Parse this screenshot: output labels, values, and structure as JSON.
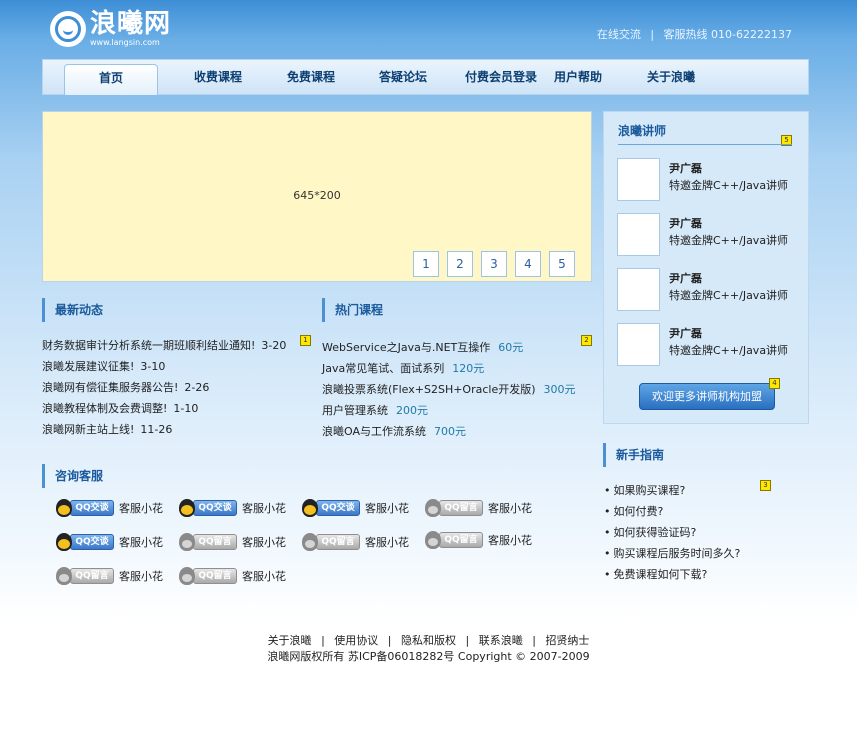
{
  "header": {
    "logo_text": "浪曦网",
    "logo_url": "www.langsin.com",
    "link_online": "在线交流",
    "separator": "|",
    "hotline": "客服热线 010-62222137"
  },
  "nav": {
    "items": [
      {
        "label": "首页"
      },
      {
        "label": "收费课程"
      },
      {
        "label": "免费课程"
      },
      {
        "label": "答疑论坛"
      },
      {
        "label": "付费会员登录"
      },
      {
        "label": "用户帮助"
      },
      {
        "label": "关于浪曦"
      }
    ]
  },
  "banner": {
    "label": "645*200",
    "pages": [
      "1",
      "2",
      "3",
      "4",
      "5"
    ]
  },
  "news": {
    "title": "最新动态",
    "badge": "1",
    "items": [
      {
        "text": "财务数据审计分析系统一期班顺利结业通知!",
        "date": "3-20"
      },
      {
        "text": "浪曦发展建议征集!",
        "date": "3-10"
      },
      {
        "text": "浪曦网有偿征集服务器公告!",
        "date": "2-26"
      },
      {
        "text": "浪曦教程体制及会费调整!",
        "date": "1-10"
      },
      {
        "text": "浪曦网新主站上线!",
        "date": "11-26"
      }
    ]
  },
  "courses": {
    "title": "热门课程",
    "badge": "2",
    "items": [
      {
        "text": "WebService之Java与.NET互操作",
        "price": "60元"
      },
      {
        "text": "Java常见笔试、面试系列",
        "price": "120元"
      },
      {
        "text": "浪曦投票系统(Flex+S2SH+Oracle开发版)",
        "price": "300元"
      },
      {
        "text": "用户管理系统",
        "price": "200元"
      },
      {
        "text": "浪曦OA与工作流系统",
        "price": "700元"
      }
    ]
  },
  "service": {
    "title": "咨询客服",
    "online_tag": "QQ交谈",
    "offline_tag": "QQ留言",
    "agents": [
      {
        "name": "客服小花",
        "status": "online"
      },
      {
        "name": "客服小花",
        "status": "online"
      },
      {
        "name": "客服小花",
        "status": "online"
      },
      {
        "name": "客服小花",
        "status": "offline"
      },
      {
        "name": "客服小花",
        "status": "online"
      },
      {
        "name": "客服小花",
        "status": "offline"
      },
      {
        "name": "客服小花",
        "status": "offline"
      },
      {
        "name": "客服小花",
        "status": "offline"
      },
      {
        "name": "客服小花",
        "status": "offline"
      },
      {
        "name": "客服小花",
        "status": "offline"
      }
    ]
  },
  "teachers": {
    "title": "浪曦讲师",
    "badge": "5",
    "items": [
      {
        "name": "尹广磊",
        "title": "特邀金牌C++/Java讲师"
      },
      {
        "name": "尹广磊",
        "title": "特邀金牌C++/Java讲师"
      },
      {
        "name": "尹广磊",
        "title": "特邀金牌C++/Java讲师"
      },
      {
        "name": "尹广磊",
        "title": "特邀金牌C++/Java讲师"
      }
    ],
    "join_label": "欢迎更多讲师机构加盟",
    "join_badge": "4"
  },
  "guide": {
    "title": "新手指南",
    "badge": "3",
    "items": [
      "如果购买课程?",
      "如何付费?",
      "如何获得验证码?",
      "购买课程后服务时间多久?",
      "免费课程如何下载?"
    ]
  },
  "footer": {
    "links": [
      "关于浪曦",
      "使用协议",
      "隐私和版权",
      "联系浪曦",
      "招贤纳士"
    ],
    "separator": "|",
    "copyright": "浪曦网版权所有 苏ICP备06018282号 Copyright © 2007-2009"
  }
}
